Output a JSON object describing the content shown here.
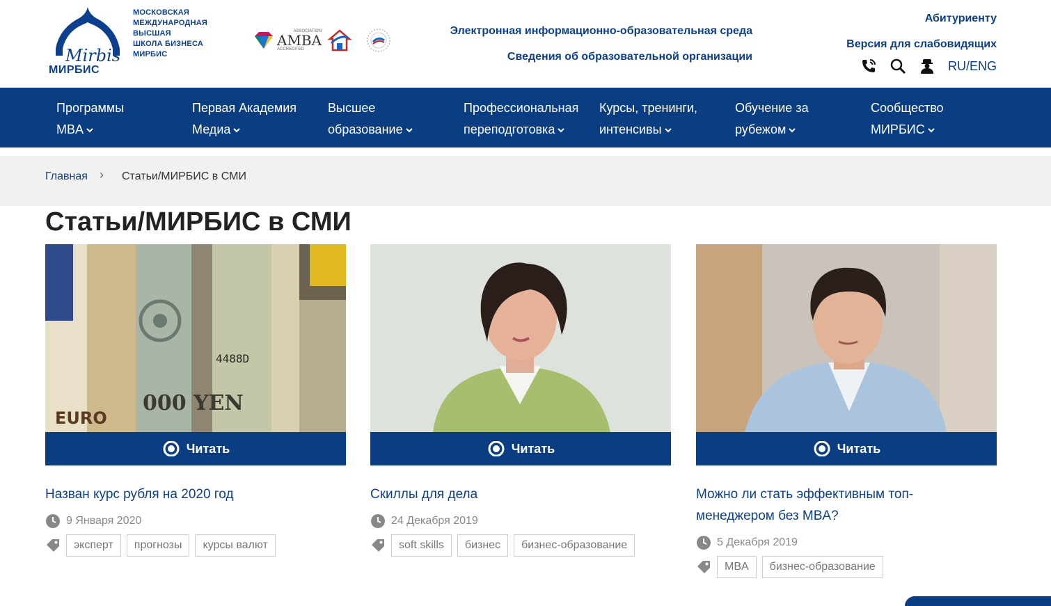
{
  "header": {
    "logo_lines": [
      "МОСКОВСКАЯ",
      "МЕЖДУНАРОДНАЯ",
      "ВЫСШАЯ",
      "ШКОЛА БИЗНЕСА",
      "МИРБИС"
    ],
    "logo_script": "Mirbis",
    "logo_name": "МИРБИС",
    "accreditation_label": "AMBA",
    "accreditation_sub": "ACCREDITED",
    "accreditation_top": "ASSOCIATION",
    "link_eios": "Электронная информационно-образовательная среда",
    "link_info": "Сведения об образовательной организации",
    "link_applicant": "Абитуриенту",
    "link_accessible": "Версия для слабовидящих",
    "lang": "RU/ENG"
  },
  "nav": {
    "items": [
      {
        "line1": "Программы",
        "line2": "MBA"
      },
      {
        "line1": "Первая Академия",
        "line2": "Медиа"
      },
      {
        "line1": "Высшее",
        "line2": "образование"
      },
      {
        "line1": "Профессиональная",
        "line2": "переподготовка"
      },
      {
        "line1": "Курсы, тренинги,",
        "line2": "интенсивы"
      },
      {
        "line1": "Обучение за",
        "line2": "рубежом"
      },
      {
        "line1": "Сообщество",
        "line2": "МИРБИС"
      }
    ]
  },
  "breadcrumb": {
    "home": "Главная",
    "current": "Статьи/МИРБИС в СМИ"
  },
  "page_title": "Статьи/МИРБИС в СМИ",
  "read_label": "Читать",
  "cards": [
    {
      "title": "Назван курс рубля на 2020 год",
      "date": "9 Января 2020",
      "tags": [
        "эксперт",
        "прогнозы",
        "курсы валют"
      ],
      "image_text_euro": "EURO",
      "image_text_yen": "000 YEN",
      "image_text_num": "4488D"
    },
    {
      "title": "Скиллы для дела",
      "date": "24 Декабря 2019",
      "tags": [
        "soft skills",
        "бизнес",
        "бизнес-образование"
      ]
    },
    {
      "title_line1": "Можно ли стать эффективным топ-",
      "title_line2": "менеджером без MBA?",
      "date": "5 Декабря 2019",
      "tags": [
        "MBA",
        "бизнес-образование"
      ]
    }
  ],
  "colors": {
    "brand": "#0a3d82",
    "link": "#0d3f8f",
    "breadcrumb_bg": "#f1f1f1"
  }
}
